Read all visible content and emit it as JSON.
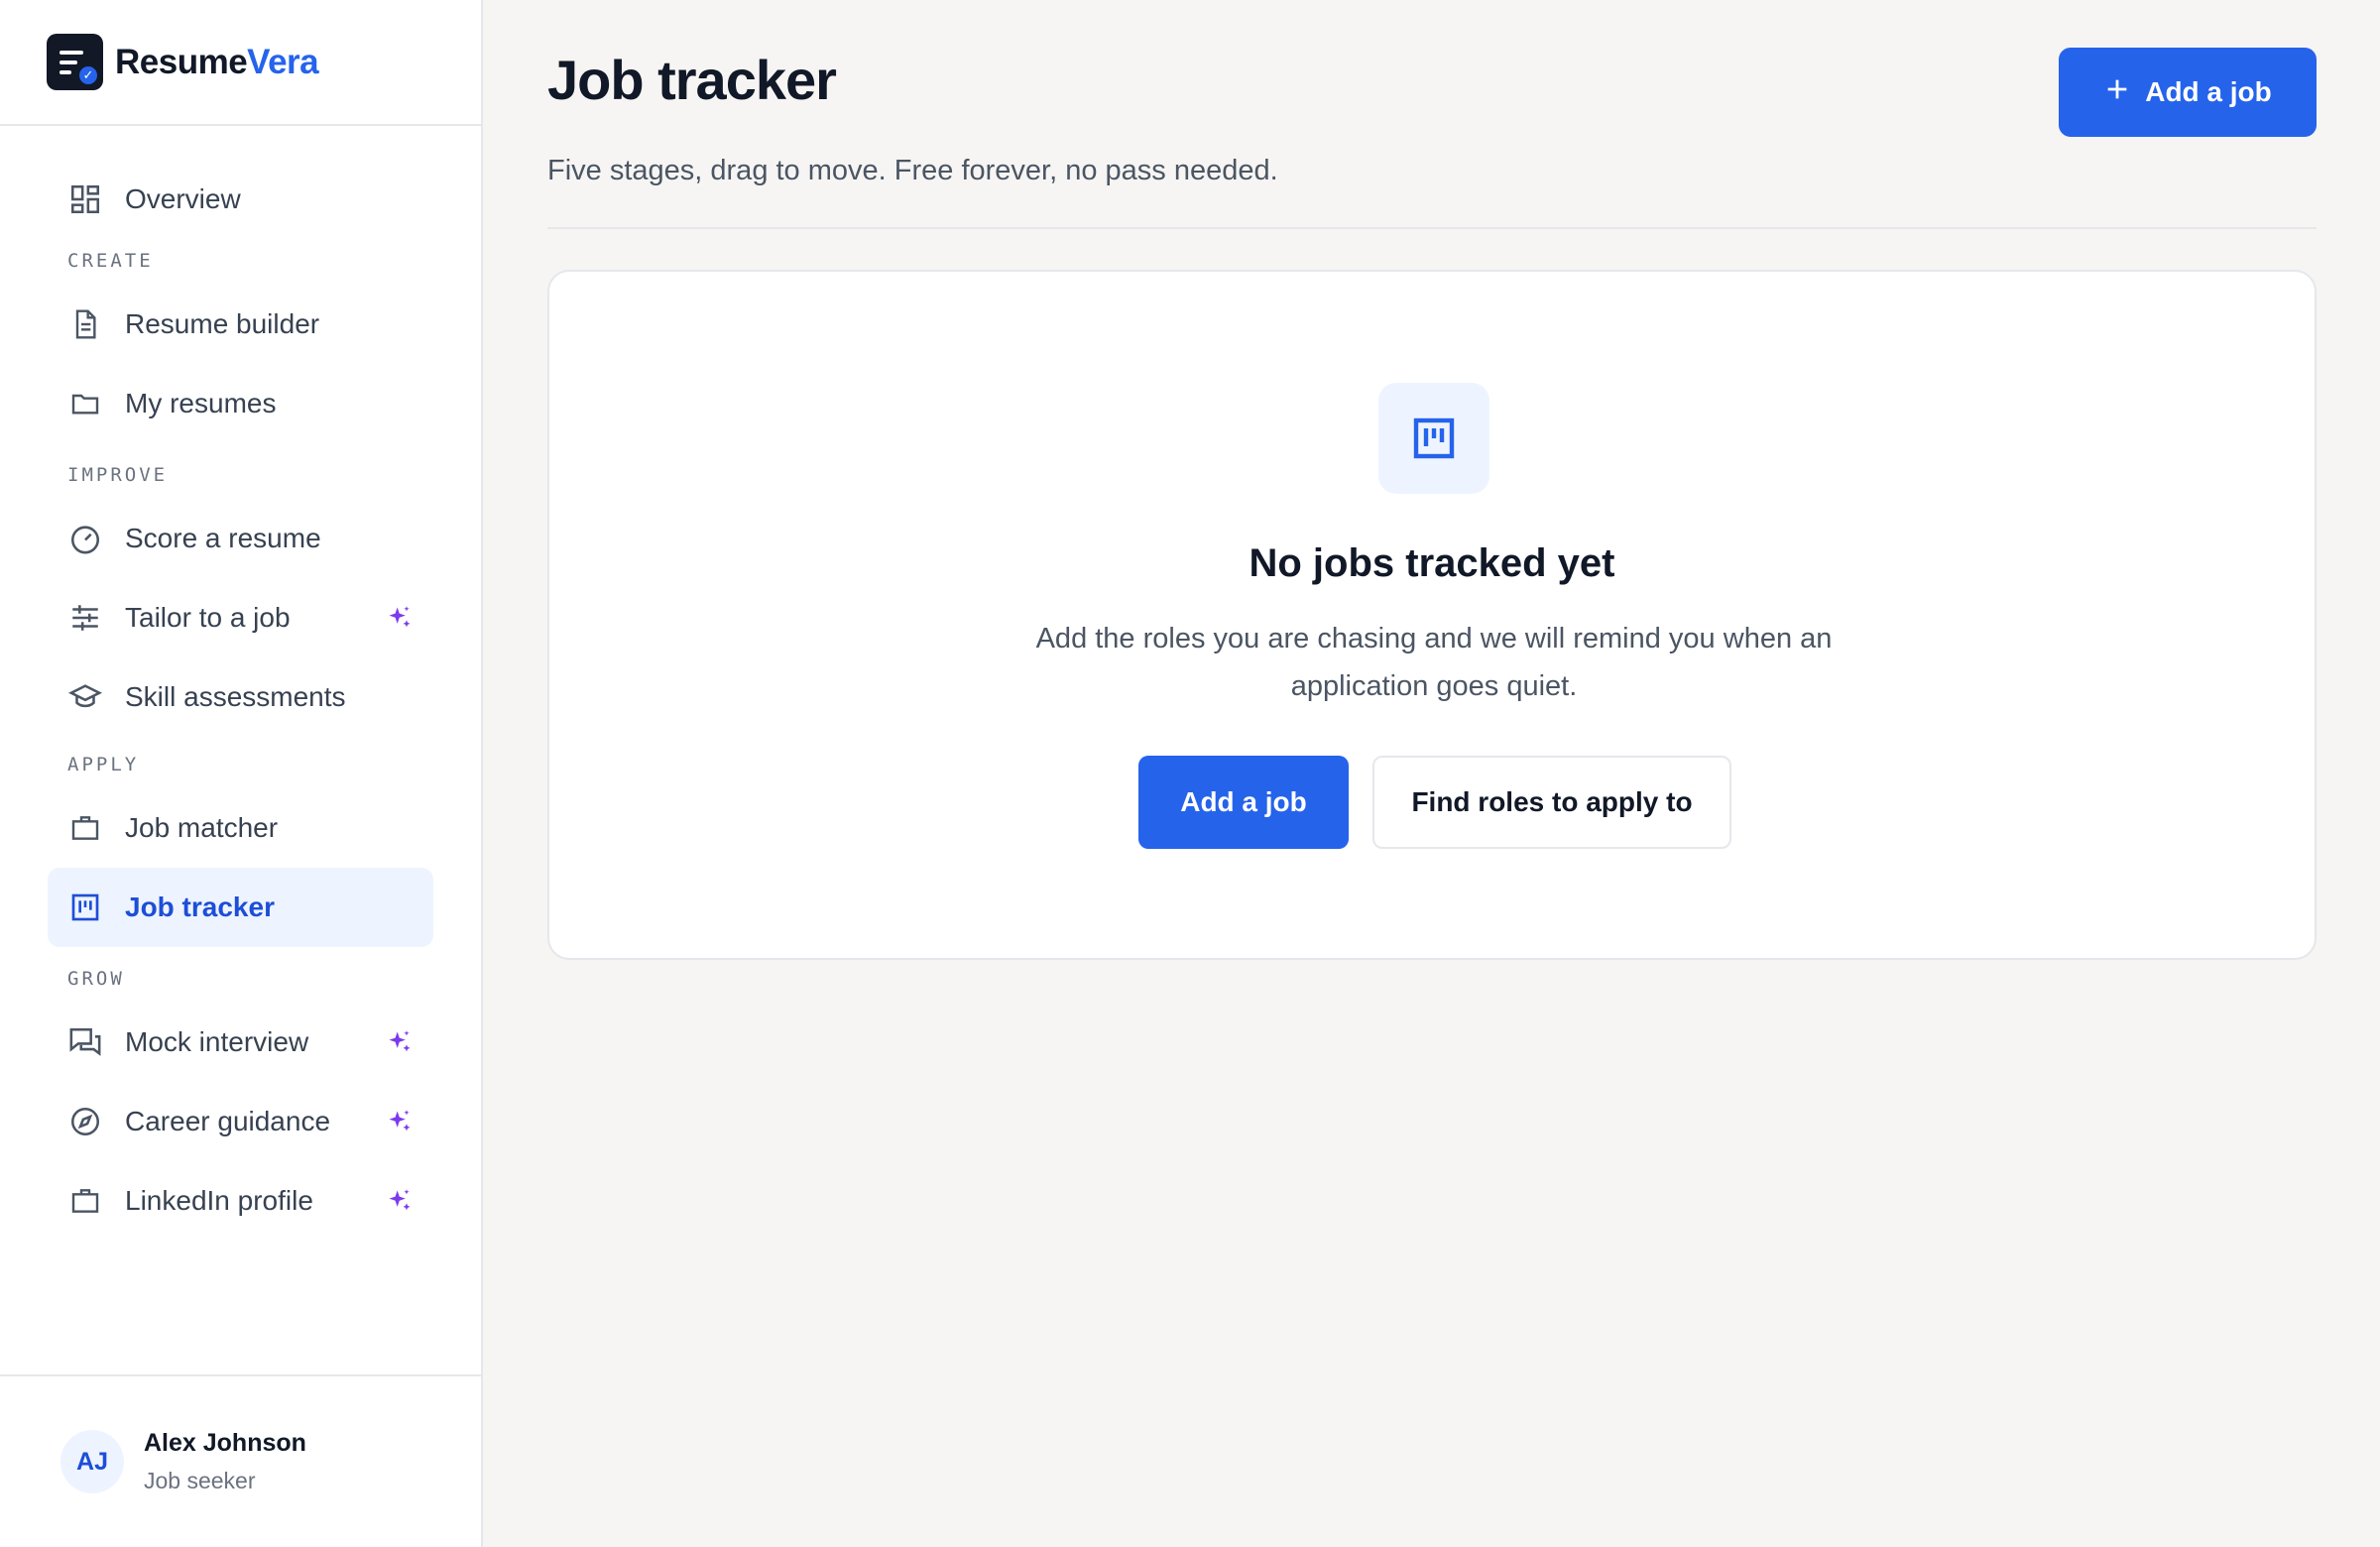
{
  "brand": {
    "name_main": "Resume",
    "name_accent": "Vera"
  },
  "sidebar": {
    "overview": {
      "label": "Overview",
      "icon": "dashboard-icon"
    },
    "sections": {
      "create": "CREATE",
      "improve": "IMPROVE",
      "apply": "APPLY",
      "grow": "GROW"
    },
    "items": {
      "resume_builder": {
        "label": "Resume builder",
        "icon": "document-icon"
      },
      "my_resumes": {
        "label": "My resumes",
        "icon": "folder-icon"
      },
      "score_resume": {
        "label": "Score a resume",
        "icon": "gauge-icon"
      },
      "tailor_job": {
        "label": "Tailor to a job",
        "icon": "sliders-icon",
        "ai": true
      },
      "skill_assessments": {
        "label": "Skill assessments",
        "icon": "graduation-cap-icon"
      },
      "job_matcher": {
        "label": "Job matcher",
        "icon": "briefcase-icon"
      },
      "job_tracker": {
        "label": "Job tracker",
        "icon": "kanban-icon",
        "active": true
      },
      "mock_interview": {
        "label": "Mock interview",
        "icon": "chat-icon",
        "ai": true
      },
      "career_guidance": {
        "label": "Career guidance",
        "icon": "compass-icon",
        "ai": true
      },
      "linkedin_profile": {
        "label": "LinkedIn profile",
        "icon": "briefcase-icon",
        "ai": true
      }
    }
  },
  "user": {
    "initials": "AJ",
    "name": "Alex Johnson",
    "role": "Job seeker"
  },
  "header": {
    "title": "Job tracker",
    "subtitle": "Five stages, drag to move. Free forever, no pass needed.",
    "add_button": "Add a job"
  },
  "empty_state": {
    "icon": "kanban-icon",
    "title": "No jobs tracked yet",
    "description": "Add the roles you are chasing and we will remind you when an application goes quiet.",
    "primary_button": "Add a job",
    "secondary_button": "Find roles to apply to"
  },
  "colors": {
    "accent": "#2563eb",
    "ai_sparkle": "#7c3aed",
    "active_bg": "#eef4ff",
    "background": "#f6f5f3"
  }
}
